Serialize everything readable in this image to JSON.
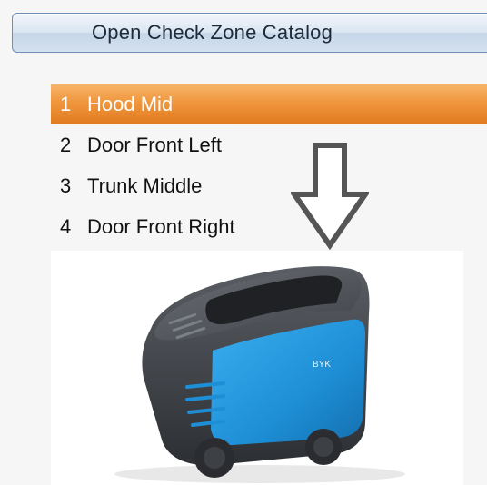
{
  "catalog_button": {
    "label": "Open Check Zone Catalog"
  },
  "zones": [
    {
      "number": "1",
      "label": "Hood Mid",
      "selected": true
    },
    {
      "number": "2",
      "label": "Door Front Left",
      "selected": false
    },
    {
      "number": "3",
      "label": "Trunk Middle",
      "selected": false
    },
    {
      "number": "4",
      "label": "Door Front Right",
      "selected": false
    }
  ],
  "device": {
    "brand_logo": "BYK",
    "colors": {
      "body_blue": "#1e8fd6",
      "body_dark": "#3a3d42",
      "screen": "#202225"
    }
  },
  "colors": {
    "selection_orange": "#f0963c",
    "button_border": "#6e8fb3"
  }
}
